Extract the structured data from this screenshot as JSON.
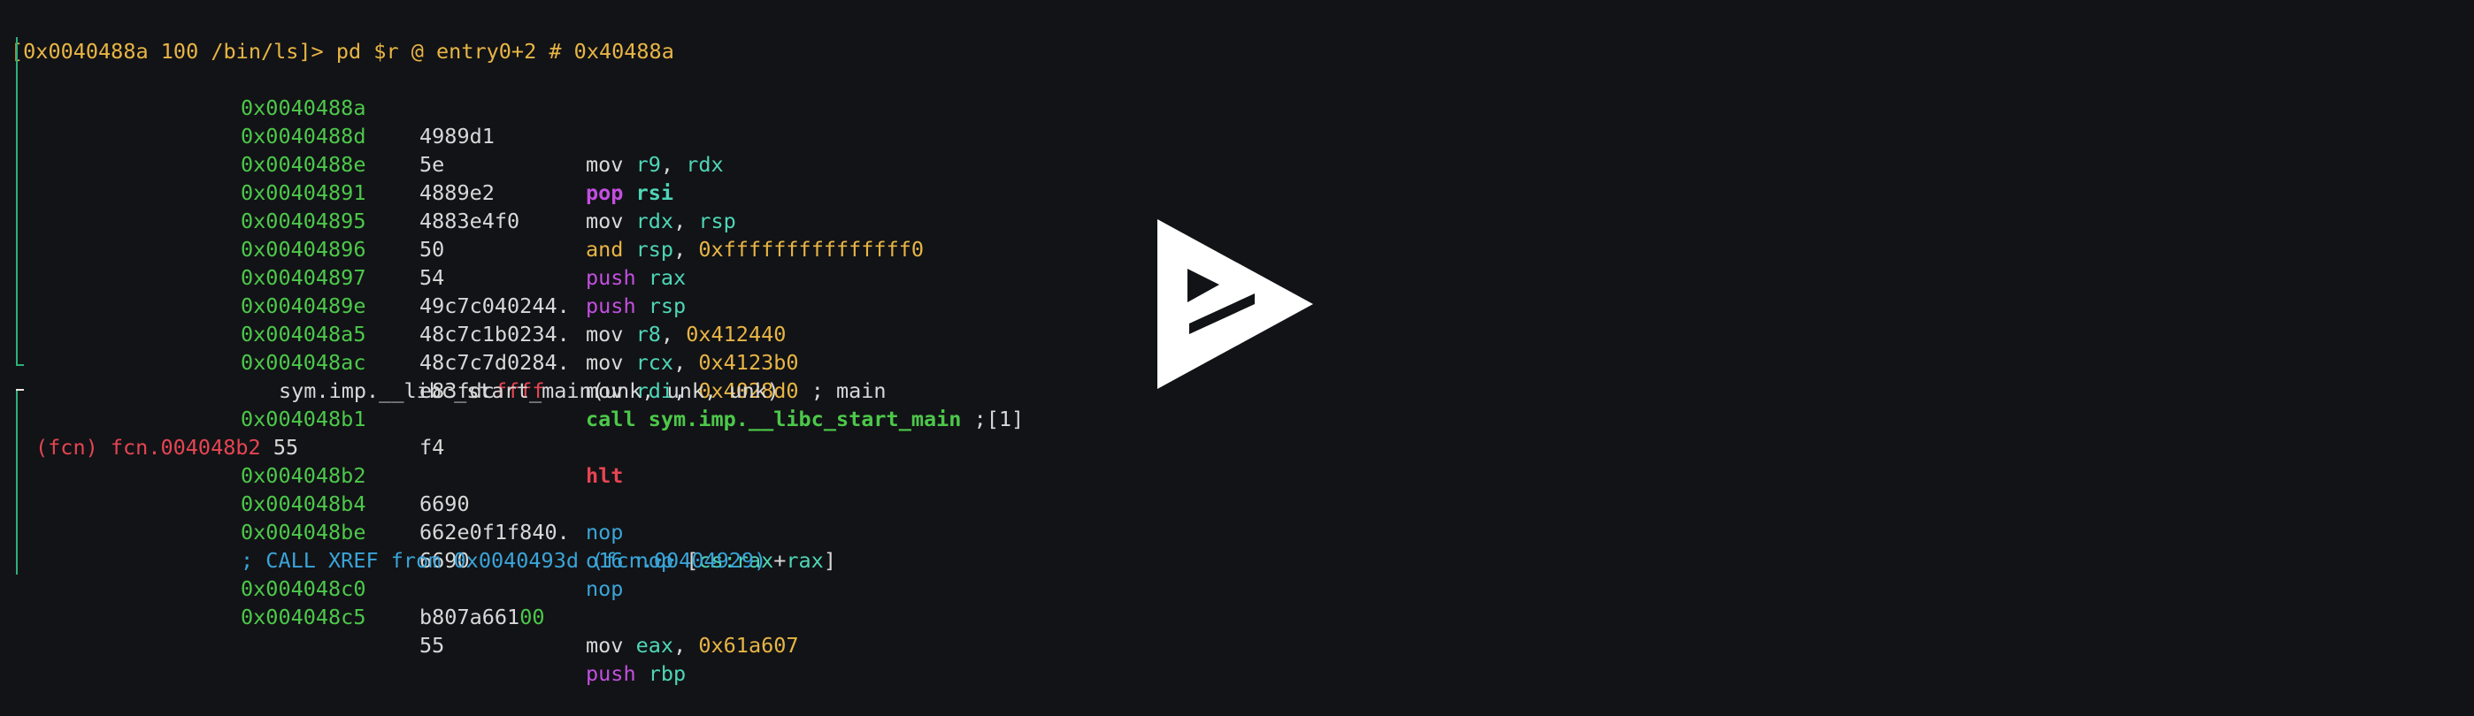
{
  "prompt": "[0x0040488a 100 /bin/ls]> pd $r @ entry0+2 # 0x40488a",
  "lines": [
    {
      "addr": "0x0040488a",
      "bytes": "4989d1",
      "op": "mov",
      "a": "r9",
      "sep": ", ",
      "b": "rdx"
    },
    {
      "addr": "0x0040488d",
      "bytes": "5e",
      "op": "pop",
      "a": "rsi"
    },
    {
      "addr": "0x0040488e",
      "bytes": "4889e2",
      "op": "mov",
      "a": "rdx",
      "sep": ", ",
      "b": "rsp"
    },
    {
      "addr": "0x00404891",
      "bytes": "4883e4f0",
      "op": "and",
      "a": "rsp",
      "sep": ", ",
      "b": "0xfffffffffffffff0"
    },
    {
      "addr": "0x00404895",
      "bytes": "50",
      "op": "push",
      "a": "rax"
    },
    {
      "addr": "0x00404896",
      "bytes": "54",
      "op": "push",
      "a": "rsp"
    },
    {
      "addr": "0x00404897",
      "bytes": "49c7c040244.",
      "op": "mov",
      "a": "r8",
      "sep": ", ",
      "b": "0x412440"
    },
    {
      "addr": "0x0040489e",
      "bytes": "48c7c1b0234.",
      "op": "mov",
      "a": "rcx",
      "sep": ", ",
      "b": "0x4123b0"
    },
    {
      "addr": "0x004048a5",
      "bytes": "48c7c7d0284.",
      "op": "mov",
      "a": "rdi",
      "sep": ", ",
      "b": "0x4028d0",
      "comment": " ; main"
    },
    {
      "addr": "0x004048ac",
      "bytes_a": "e83fdc",
      "bytes_b": "ffff",
      "op": "call sym.imp.__libc_start_main",
      "comment": " ;[1]"
    },
    {
      "sig": "sym.imp.__libc_start_main(unk, unk, unk)"
    },
    {
      "addr": "0x004048b1",
      "bytes": "f4",
      "op": "hlt"
    },
    {
      "fcn": "(fcn) fcn.004048b2",
      "size": " 55"
    },
    {
      "addr": "0x004048b2",
      "bytes": "6690",
      "op": "nop"
    },
    {
      "addr": "0x004048b4",
      "bytes": "662e0f1f840.",
      "pre": "o16 ",
      "op": "nop",
      "lb": " [",
      "seg": "cs:rax",
      "plus": "+",
      "b": "rax",
      "rb": "]"
    },
    {
      "addr": "0x004048be",
      "bytes": "6690",
      "op": "nop"
    },
    {
      "xref": "; CALL XREF from 0x0040493d (fcn.00404929)"
    },
    {
      "addr": "0x004048c0",
      "bytes_a": "b807a661",
      "bytes_g": "00",
      "op": "mov",
      "a": "eax",
      "sep": ", ",
      "b": "0x61a607"
    },
    {
      "addr": "0x004048c5",
      "bytes": "55",
      "op": "push",
      "a": "rbp"
    }
  ],
  "logo": "play-logo"
}
